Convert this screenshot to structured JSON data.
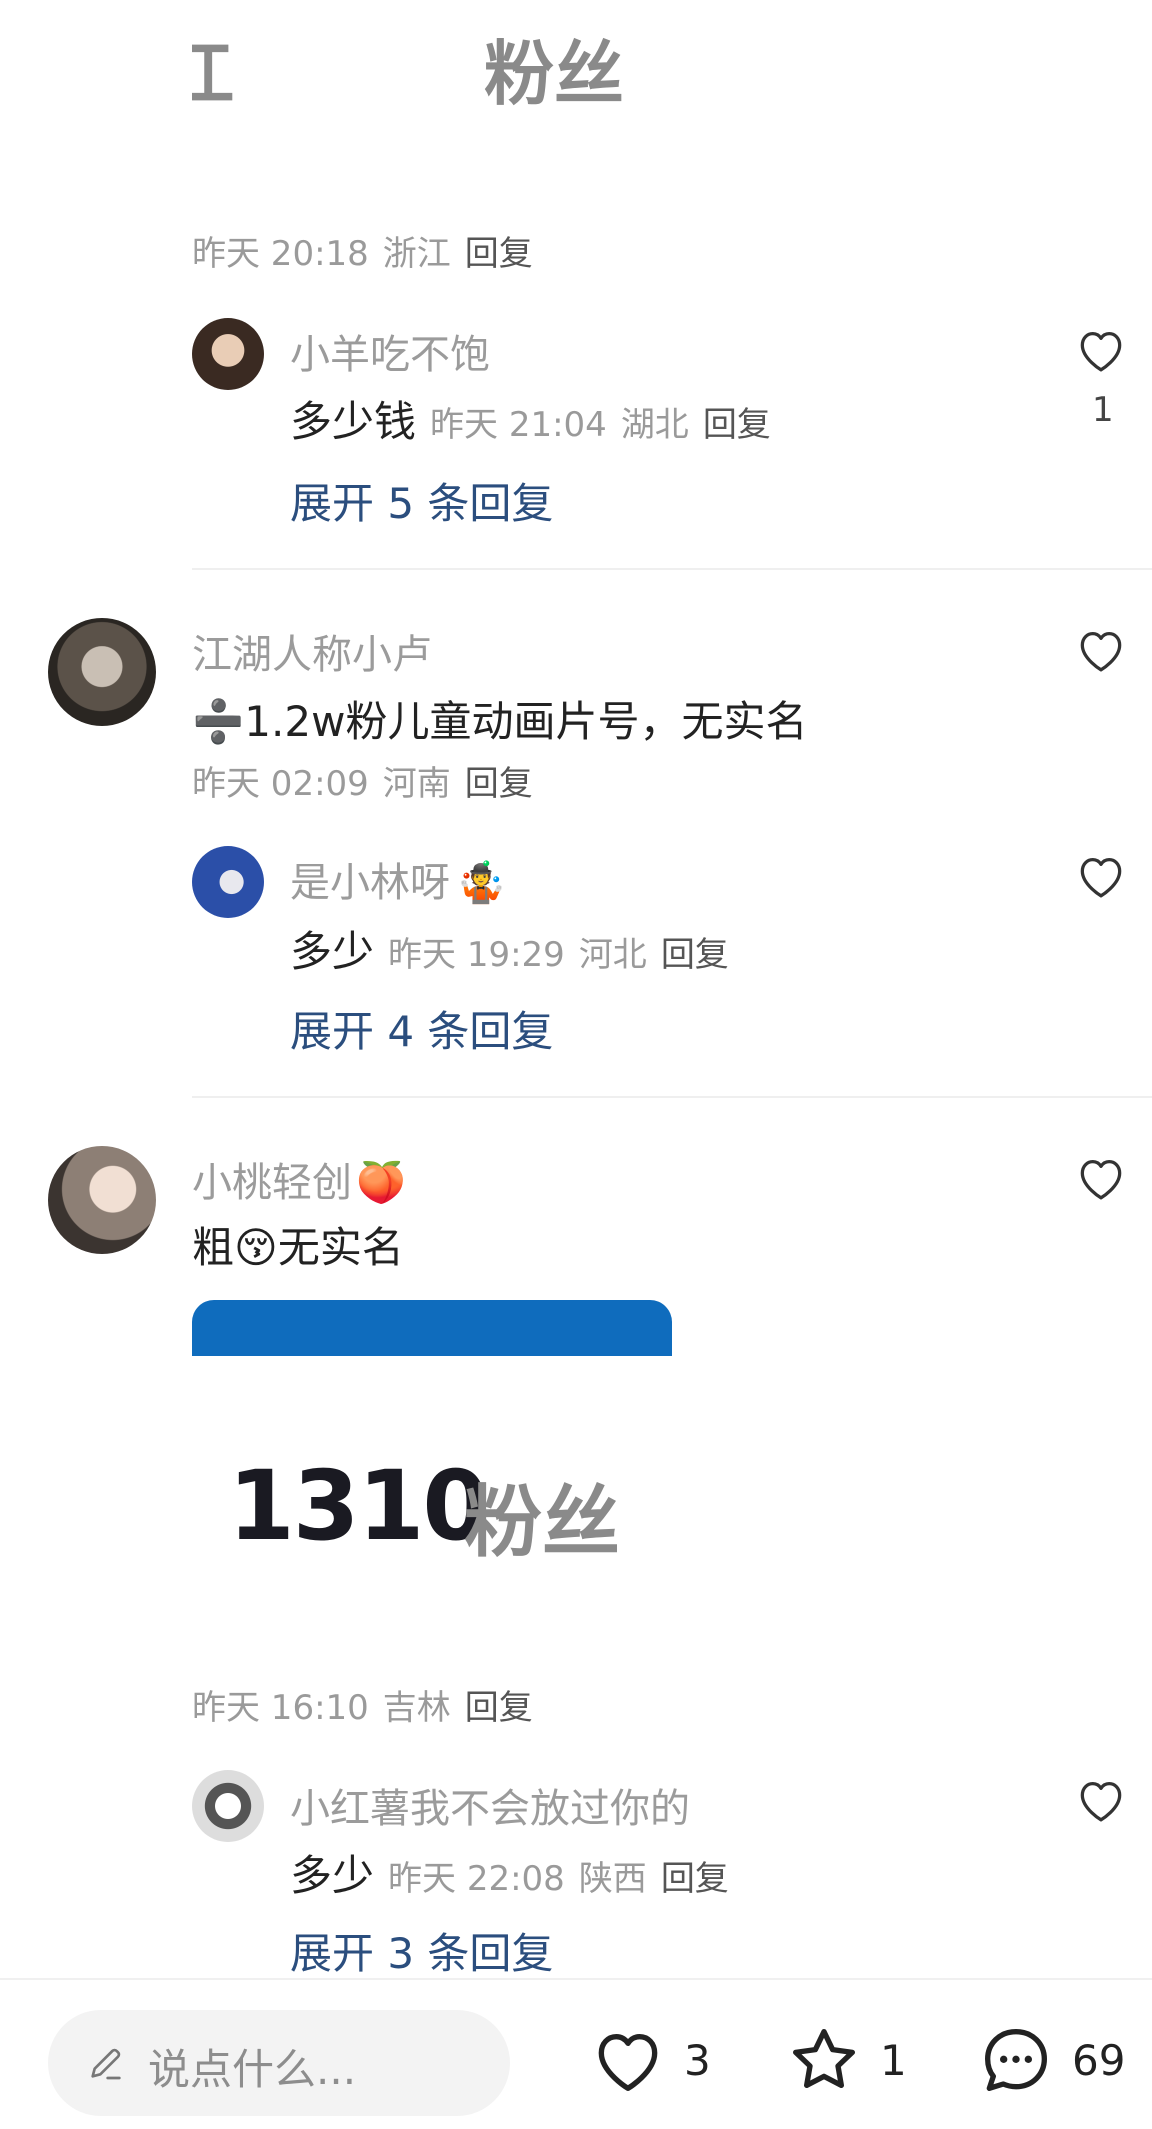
{
  "top_image": {
    "partial_text": "江",
    "fans_label": "粉丝"
  },
  "comments": [
    {
      "id": "c0",
      "meta": {
        "time": "昨天 20:18",
        "location": "浙江",
        "reply": "回复"
      },
      "replies": [
        {
          "name": "小羊吃不饱",
          "text": "多少钱",
          "time": "昨天 21:04",
          "location": "湖北",
          "reply": "回复",
          "likes": "1"
        }
      ],
      "expand": "展开 5 条回复"
    },
    {
      "id": "c1",
      "name": "江湖人称小卢",
      "text": "➗1.2w粉儿童动画片号，无实名",
      "meta": {
        "time": "昨天 02:09",
        "location": "河南",
        "reply": "回复"
      },
      "replies": [
        {
          "name": "是小林呀",
          "name_emoji": "🤹",
          "text": "多少",
          "time": "昨天 19:29",
          "location": "河北",
          "reply": "回复"
        }
      ],
      "expand": "展开 4 条回复"
    },
    {
      "id": "c2",
      "name": "小桃轻创",
      "name_emoji": "🍑",
      "text_prefix": "粗",
      "text_emoji": "😚",
      "text_suffix": "无实名",
      "image": {
        "fans_count": "1310",
        "fans_label": "粉丝"
      },
      "meta": {
        "time": "昨天 16:10",
        "location": "吉林",
        "reply": "回复"
      },
      "replies": [
        {
          "name": "小红薯我不会放过你的",
          "text": "多少",
          "time": "昨天 22:08",
          "location": "陕西",
          "reply": "回复"
        }
      ],
      "expand": "展开 3 条回复"
    }
  ],
  "bottom_bar": {
    "input_placeholder": "说点什么...",
    "likes": "3",
    "favorites": "1",
    "comments": "69"
  },
  "colors": {
    "link_blue": "#2b4e7e",
    "meta_gray": "#9a9a9a",
    "image_bar_blue": "#0f6cbd"
  },
  "icons": [
    "heart-icon",
    "star-icon",
    "chat-bubble-icon",
    "pencil-icon"
  ]
}
